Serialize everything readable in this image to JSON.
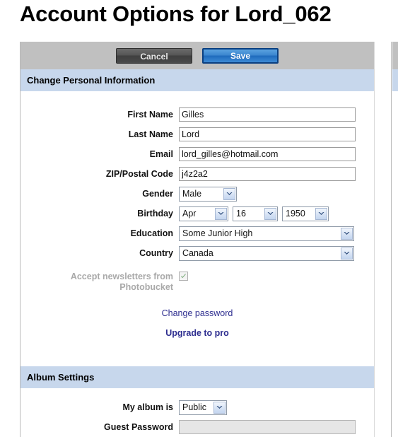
{
  "page": {
    "title": "Account Options for Lord_062"
  },
  "toolbar": {
    "cancel_label": "Cancel",
    "save_label": "Save",
    "background_color": "#c0c0c0",
    "save_color": "#2f7fd0",
    "cancel_color": "#4a4a4a"
  },
  "sections": {
    "personal": {
      "header": "Change Personal Information",
      "header_color": "#c7d7ec",
      "fields": {
        "first_name": {
          "label": "First Name",
          "value": "Gilles",
          "placeholder": ""
        },
        "last_name": {
          "label": "Last Name",
          "value": "Lord",
          "placeholder": ""
        },
        "email": {
          "label": "Email",
          "value": "lord_gilles@hotmail.com",
          "placeholder": ""
        },
        "zip": {
          "label": "ZIP/Postal Code",
          "value": "j4z2a2",
          "placeholder": ""
        },
        "gender": {
          "label": "Gender",
          "value": "Male"
        },
        "birthday": {
          "label": "Birthday",
          "month": "Apr",
          "day": "16",
          "year": "1950"
        },
        "education": {
          "label": "Education",
          "value": "Some Junior High"
        },
        "country": {
          "label": "Country",
          "value": "Canada"
        },
        "newsletter": {
          "label": "Accept newsletters from Photobucket",
          "checked": "checked",
          "label_color": "#a9a9a9"
        }
      },
      "links": {
        "change_password": "Change password",
        "upgrade_to_pro": "Upgrade to pro",
        "link_color": "#2d2d8f"
      }
    },
    "album": {
      "header": "Album Settings",
      "fields": {
        "album_visibility": {
          "label": "My album is",
          "value": "Public"
        },
        "guest_password": {
          "label": "Guest Password",
          "value": "",
          "placeholder": ""
        }
      }
    }
  },
  "icons": {
    "chevron_down": "chevron-down-icon",
    "checkmark": "check-icon"
  }
}
